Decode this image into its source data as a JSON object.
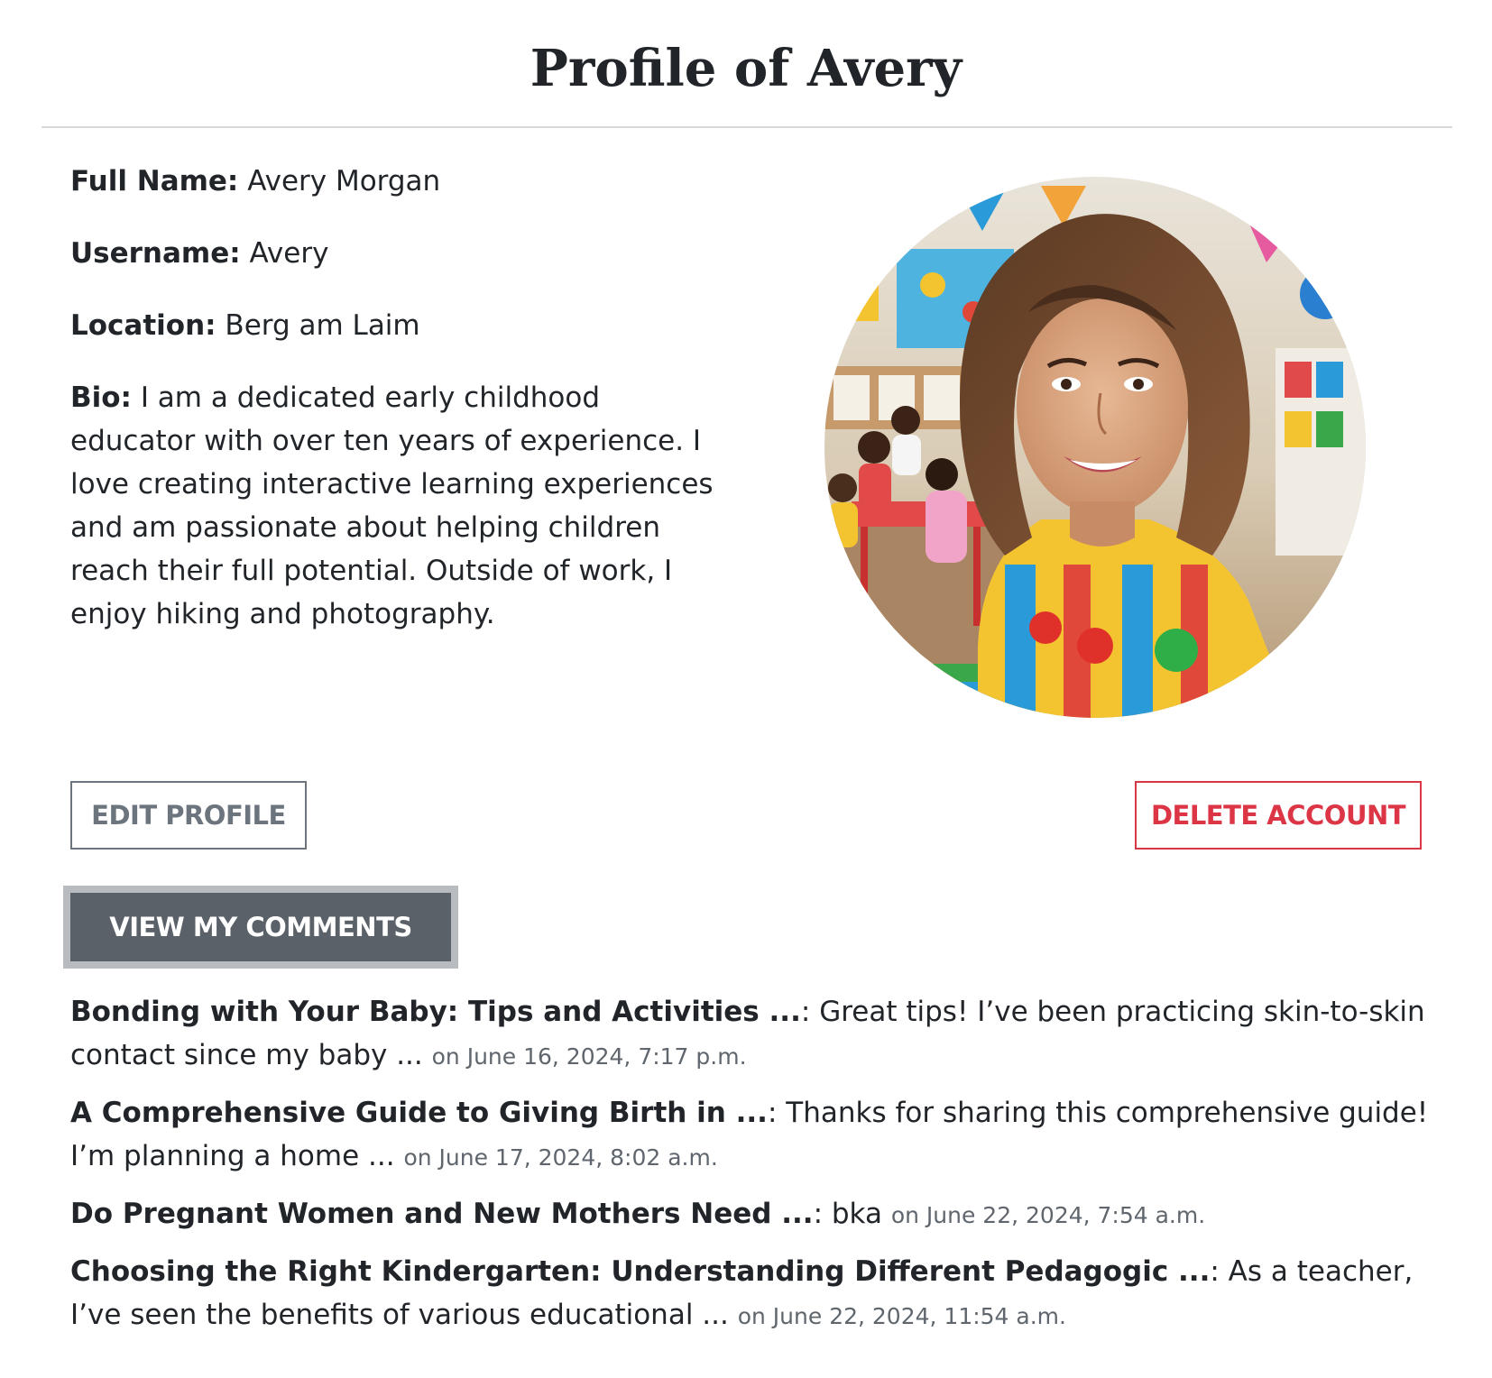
{
  "page": {
    "title": "Profile of Avery"
  },
  "profile": {
    "full_name_label": "Full Name:",
    "full_name": "Avery Morgan",
    "username_label": "Username:",
    "username": "Avery",
    "location_label": "Location:",
    "location": "Berg am Laim",
    "bio_label": "Bio:",
    "bio": "I am a dedicated early childhood educator with over ten years of experience. I love creating interactive learning experiences and am passionate about helping children reach their full potential. Outside of work, I enjoy hiking and photography.",
    "avatar_icon": "profile-photo"
  },
  "actions": {
    "edit_label": "EDIT PROFILE",
    "delete_label": "DELETE ACCOUNT",
    "view_comments_label": "VIEW MY COMMENTS"
  },
  "comments": [
    {
      "title": "Bonding with Your Baby: Tips and Activities ...",
      "separator": ":",
      "text": "Great tips! I’ve been practicing skin-to-skin contact since my baby ...",
      "date": "on June 16, 2024, 7:17 p.m."
    },
    {
      "title": "A Comprehensive Guide to Giving Birth in ...",
      "separator": ":",
      "text": "Thanks for sharing this comprehensive guide! I’m planning a home ...",
      "date": "on June 17, 2024, 8:02 a.m."
    },
    {
      "title": "Do Pregnant Women and New Mothers Need ...",
      "separator": ":",
      "text": "bka",
      "date": "on June 22, 2024, 7:54 a.m."
    },
    {
      "title": "Choosing the Right Kindergarten: Understanding Different Pedagogic ...",
      "separator": ":",
      "text": "As a teacher, I’ve seen the benefits of various educational ...",
      "date": "on June 22, 2024, 11:54 a.m."
    }
  ],
  "colors": {
    "text": "#212529",
    "secondary": "#6c757d",
    "danger": "#dc3545",
    "dark_button": "#5a6168",
    "muted_date": "#5f666d"
  }
}
